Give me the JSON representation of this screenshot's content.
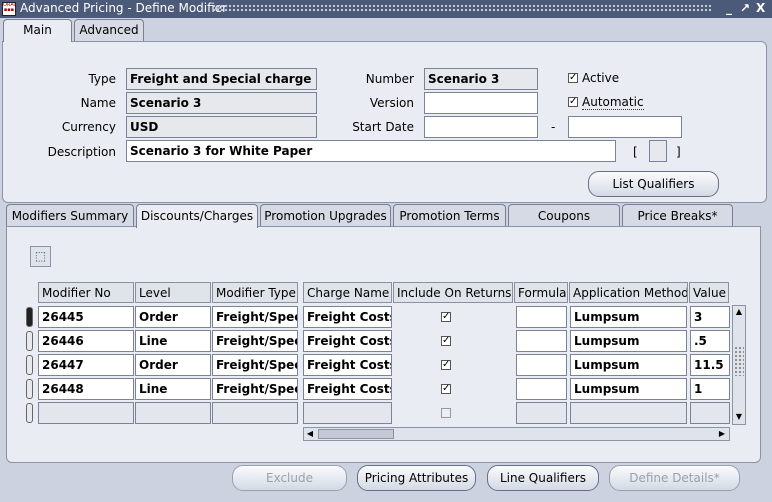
{
  "window": {
    "title": "Advanced Pricing - Define Modifier",
    "controls": [
      "_",
      "↗",
      "X"
    ]
  },
  "top_tabs": [
    {
      "label": "Main",
      "active": true
    },
    {
      "label": "Advanced",
      "active": false
    }
  ],
  "header": {
    "type_label": "Type",
    "type_value": "Freight and Special charge Li",
    "name_label": "Name",
    "name_value": "Scenario 3",
    "currency_label": "Currency",
    "currency_value": "USD",
    "description_label": "Description",
    "description_value": "Scenario 3 for White Paper",
    "number_label": "Number",
    "number_value": "Scenario 3",
    "version_label": "Version",
    "version_value": "",
    "start_date_label": "Start Date",
    "start_date_value": "",
    "date_separator": "-",
    "end_date_value": "",
    "active_label": "Active",
    "active_checked": true,
    "automatic_label": "Automatic",
    "automatic_checked": true,
    "flex_open": "[",
    "flex_close": "]",
    "list_qualifiers_label": "List Qualifiers"
  },
  "lower_tabs": [
    {
      "label": "Modifiers Summary",
      "active": false
    },
    {
      "label": "Discounts/Charges",
      "active": true
    },
    {
      "label": "Promotion Upgrades",
      "active": false
    },
    {
      "label": "Promotion Terms",
      "active": false
    },
    {
      "label": "Coupons",
      "active": false
    },
    {
      "label": "Price Breaks*",
      "active": false
    }
  ],
  "table": {
    "columns": [
      "Modifier No",
      "Level",
      "Modifier Type",
      "Charge Name",
      "Include On Returns",
      "Formula",
      "Application Method",
      "Value"
    ],
    "rows": [
      {
        "modifier_no": "26445",
        "level": "Order",
        "modifier_type": "Freight/Spec",
        "charge_name": "Freight Costs",
        "include_on_returns": true,
        "formula": "",
        "application_method": "Lumpsum",
        "value": "3"
      },
      {
        "modifier_no": "26446",
        "level": "Line",
        "modifier_type": "Freight/Spec",
        "charge_name": "Freight Costs",
        "include_on_returns": true,
        "formula": "",
        "application_method": "Lumpsum",
        "value": ".5"
      },
      {
        "modifier_no": "26447",
        "level": "Order",
        "modifier_type": "Freight/Spec",
        "charge_name": "Freight Costs",
        "include_on_returns": true,
        "formula": "",
        "application_method": "Lumpsum",
        "value": "11.5"
      },
      {
        "modifier_no": "26448",
        "level": "Line",
        "modifier_type": "Freight/Spec",
        "charge_name": "Freight Costs",
        "include_on_returns": true,
        "formula": "",
        "application_method": "Lumpsum",
        "value": "1"
      },
      {
        "modifier_no": "",
        "level": "",
        "modifier_type": "",
        "charge_name": "",
        "include_on_returns": false,
        "formula": "",
        "application_method": "",
        "value": ""
      }
    ]
  },
  "buttons": {
    "exclude": "Exclude",
    "pricing_attributes": "Pricing Attributes",
    "line_qualifiers": "Line Qualifiers",
    "define_details": "Define Details*"
  },
  "colors": {
    "titlebar": "#4b5a78",
    "background": "#ccd2df",
    "panel": "#e9ecf2"
  }
}
